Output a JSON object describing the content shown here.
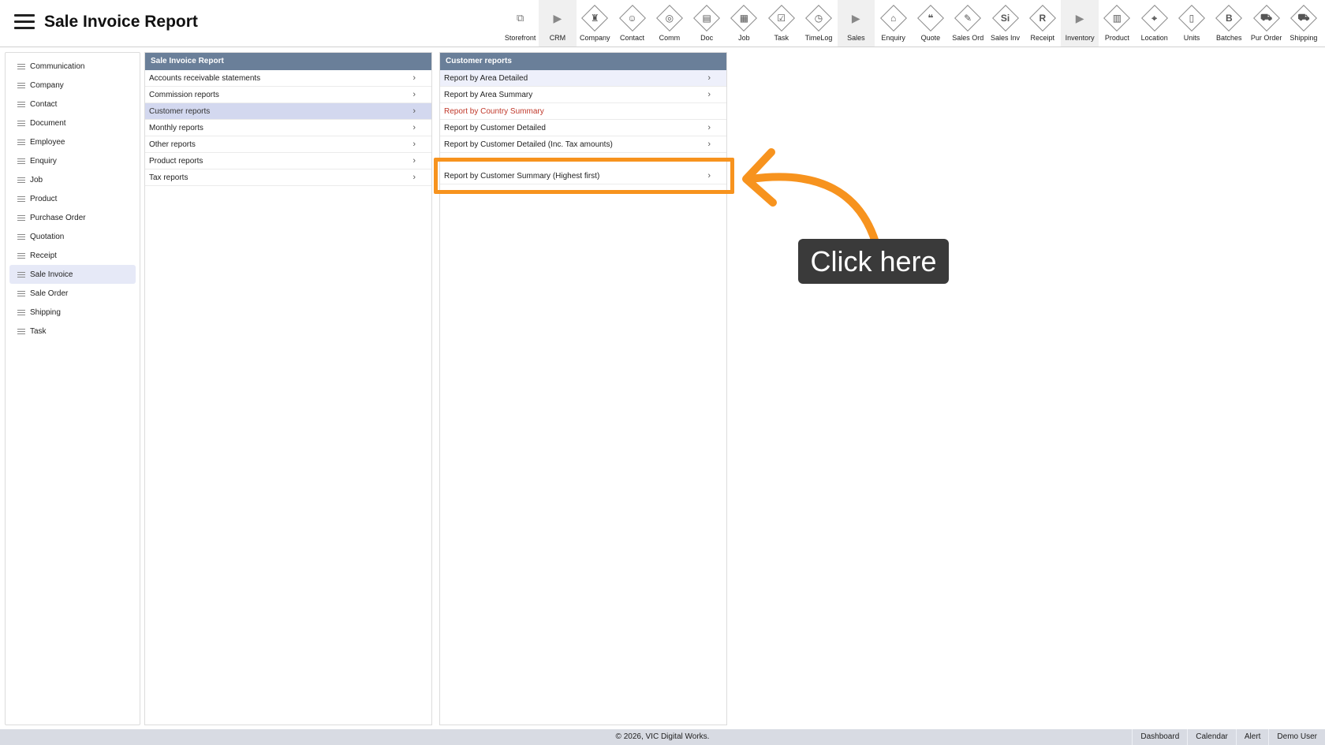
{
  "header": {
    "title": "Sale Invoice Report"
  },
  "toolbar": [
    {
      "label": "Storefront",
      "icon": "external-link-icon",
      "glyph": "⧉",
      "kind": "ext"
    },
    {
      "label": "CRM",
      "icon": "caret-right-icon",
      "glyph": "▶",
      "kind": "group"
    },
    {
      "label": "Company",
      "icon": "company-icon",
      "glyph": "♜",
      "kind": "diamond"
    },
    {
      "label": "Contact",
      "icon": "contact-icon",
      "glyph": "☺",
      "kind": "diamond"
    },
    {
      "label": "Comm",
      "icon": "comm-icon",
      "glyph": "◎",
      "kind": "diamond"
    },
    {
      "label": "Doc",
      "icon": "doc-icon",
      "glyph": "▤",
      "kind": "diamond"
    },
    {
      "label": "Job",
      "icon": "job-icon",
      "glyph": "▦",
      "kind": "diamond"
    },
    {
      "label": "Task",
      "icon": "task-icon",
      "glyph": "☑",
      "kind": "diamond"
    },
    {
      "label": "TimeLog",
      "icon": "timelog-icon",
      "glyph": "◷",
      "kind": "diamond"
    },
    {
      "label": "Sales",
      "icon": "caret-right-icon",
      "glyph": "▶",
      "kind": "group"
    },
    {
      "label": "Enquiry",
      "icon": "enquiry-icon",
      "glyph": "⌂",
      "kind": "diamond"
    },
    {
      "label": "Quote",
      "icon": "quote-icon",
      "glyph": "❝",
      "kind": "diamond"
    },
    {
      "label": "Sales Ord",
      "icon": "sales-order-icon",
      "glyph": "✎",
      "kind": "diamond"
    },
    {
      "label": "Sales Inv",
      "icon": "sales-invoice-icon",
      "glyph": "Si",
      "kind": "diamond"
    },
    {
      "label": "Receipt",
      "icon": "receipt-icon",
      "glyph": "R",
      "kind": "diamond"
    },
    {
      "label": "Inventory",
      "icon": "caret-right-icon",
      "glyph": "▶",
      "kind": "group"
    },
    {
      "label": "Product",
      "icon": "product-icon",
      "glyph": "▥",
      "kind": "diamond"
    },
    {
      "label": "Location",
      "icon": "location-icon",
      "glyph": "⌖",
      "kind": "diamond"
    },
    {
      "label": "Units",
      "icon": "units-icon",
      "glyph": "▯",
      "kind": "diamond"
    },
    {
      "label": "Batches",
      "icon": "batches-icon",
      "glyph": "B",
      "kind": "diamond"
    },
    {
      "label": "Pur Order",
      "icon": "purchase-order-icon",
      "glyph": "⛟",
      "kind": "diamond"
    },
    {
      "label": "Shipping",
      "icon": "shipping-icon",
      "glyph": "⛟",
      "kind": "diamond"
    }
  ],
  "sidebar": {
    "items": [
      {
        "label": "Communication"
      },
      {
        "label": "Company"
      },
      {
        "label": "Contact"
      },
      {
        "label": "Document"
      },
      {
        "label": "Employee"
      },
      {
        "label": "Enquiry"
      },
      {
        "label": "Job"
      },
      {
        "label": "Product"
      },
      {
        "label": "Purchase Order"
      },
      {
        "label": "Quotation"
      },
      {
        "label": "Receipt"
      },
      {
        "label": "Sale Invoice",
        "active": true
      },
      {
        "label": "Sale Order"
      },
      {
        "label": "Shipping"
      },
      {
        "label": "Task"
      }
    ]
  },
  "panel1": {
    "title": "Sale Invoice Report",
    "rows": [
      {
        "label": "Accounts receivable statements"
      },
      {
        "label": "Commission reports"
      },
      {
        "label": "Customer reports",
        "selected": true
      },
      {
        "label": "Monthly reports"
      },
      {
        "label": "Other reports"
      },
      {
        "label": "Product reports"
      },
      {
        "label": "Tax reports"
      }
    ]
  },
  "panel2": {
    "title": "Customer reports",
    "rows": [
      {
        "label": "Report by Area Detailed",
        "chevron": true,
        "hilite": true
      },
      {
        "label": "Report by Area Summary",
        "chevron": true
      },
      {
        "label": "Report by Country Summary",
        "chevron": false,
        "red": true
      },
      {
        "label": "Report by Customer Detailed",
        "chevron": true
      },
      {
        "label": "Report by Customer Detailed (Inc. Tax amounts)",
        "chevron": true
      }
    ],
    "highlighted_row": {
      "label": "Report by Customer Summary (Highest first)"
    }
  },
  "annotation": {
    "label": "Click here",
    "color": "#f7931e"
  },
  "footer": {
    "copyright": "© 2026, VIC Digital Works.",
    "links": [
      "Dashboard",
      "Calendar",
      "Alert",
      "Demo User"
    ]
  }
}
